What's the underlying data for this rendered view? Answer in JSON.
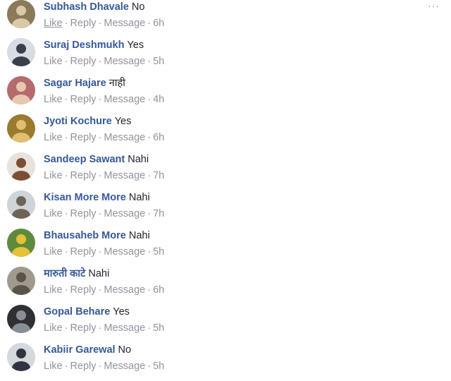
{
  "options_icon": "ellipsis-icon",
  "actions": {
    "like": "Like",
    "reply": "Reply",
    "message": "Message",
    "separator": "·"
  },
  "comments": [
    {
      "author": "Subhash Dhavale",
      "text": "No",
      "time": "6h",
      "avatar": {
        "bg": "#8a7a58",
        "fg": "#d9c9a6"
      }
    },
    {
      "author": "Suraj Deshmukh",
      "text": "Yes",
      "time": "5h",
      "avatar": {
        "bg": "#d8dde3",
        "fg": "#3a3f4a"
      }
    },
    {
      "author": "Sagar Hajare",
      "text": "नाही",
      "time": "4h",
      "avatar": {
        "bg": "#b56b6b",
        "fg": "#e8c7b0"
      }
    },
    {
      "author": "Jyoti Kochure",
      "text": "Yes",
      "time": "6h",
      "avatar": {
        "bg": "#9a7a2e",
        "fg": "#e0c070"
      }
    },
    {
      "author": "Sandeep Sawant",
      "text": "Nahi",
      "time": "7h",
      "avatar": {
        "bg": "#e7e3dc",
        "fg": "#7a4e35"
      }
    },
    {
      "author": "Kisan More More",
      "text": "Nahi",
      "time": "7h",
      "avatar": {
        "bg": "#cfd4d8",
        "fg": "#6d6458"
      }
    },
    {
      "author": "Bhausaheb More",
      "text": "Nahi",
      "time": "5h",
      "avatar": {
        "bg": "#5f8a3c",
        "fg": "#e5c23a"
      }
    },
    {
      "author": "मारुती काटे",
      "text": "Nahi",
      "time": "6h",
      "avatar": {
        "bg": "#a09a8e",
        "fg": "#5a534a"
      }
    },
    {
      "author": "Gopal Behare",
      "text": "Yes",
      "time": "5h",
      "avatar": {
        "bg": "#2e3034",
        "fg": "#8a8f96"
      }
    },
    {
      "author": "Kabiir Garewal",
      "text": "No",
      "time": "5h",
      "avatar": {
        "bg": "#d5d8dc",
        "fg": "#2f3440"
      }
    }
  ]
}
